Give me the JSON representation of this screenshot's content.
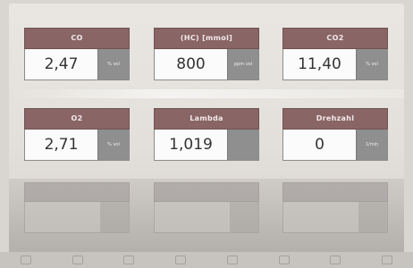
{
  "tiles": [
    {
      "title": "CO",
      "value": "2,47",
      "unit": "% vol"
    },
    {
      "title": "(HC) [mmol]",
      "value": "800",
      "unit": "ppm vol"
    },
    {
      "title": "CO2",
      "value": "11,40",
      "unit": "% vol"
    },
    {
      "title": "O2",
      "value": "2,71",
      "unit": "% vol"
    },
    {
      "title": "Lambda",
      "value": "1,019",
      "unit": ""
    },
    {
      "title": "Drehzahl",
      "value": "0",
      "unit": "1/min"
    }
  ]
}
